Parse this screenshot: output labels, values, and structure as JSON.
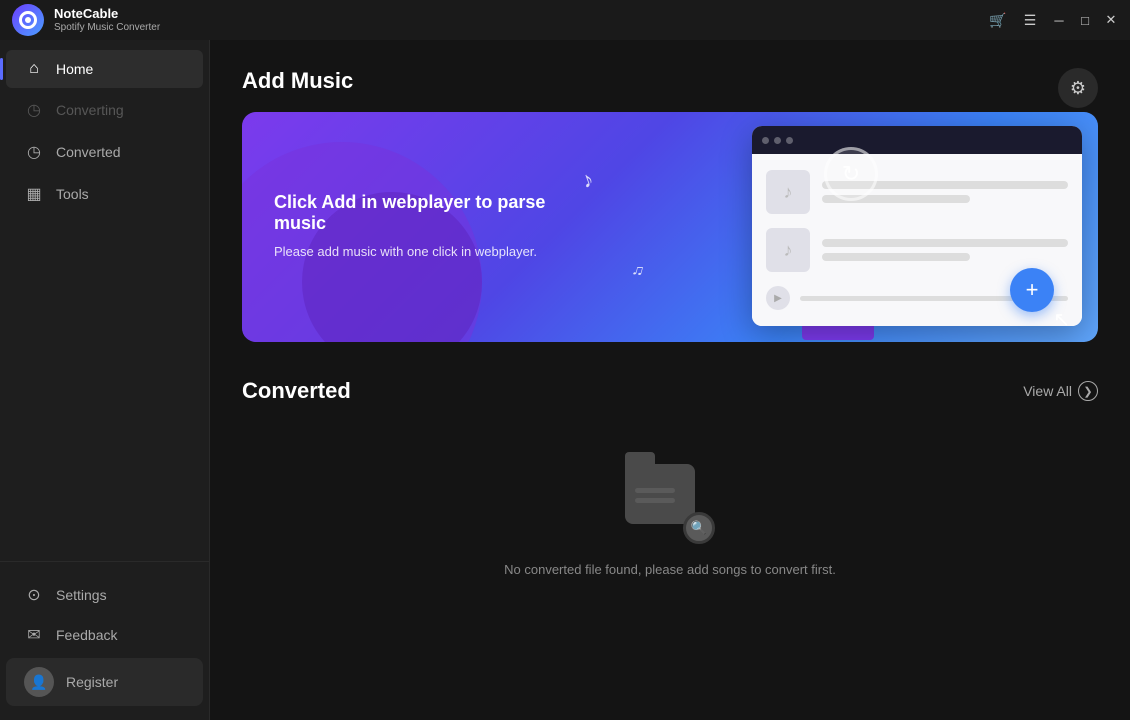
{
  "app": {
    "name": "NoteCable",
    "subtitle": "Spotify Music Converter"
  },
  "titlebar": {
    "cart_icon": "🛒",
    "menu_icon": "☰",
    "minimize_icon": "─",
    "maximize_icon": "□",
    "close_icon": "✕"
  },
  "sidebar": {
    "nav_items": [
      {
        "id": "home",
        "label": "Home",
        "icon": "⊞",
        "active": true,
        "disabled": false
      },
      {
        "id": "converting",
        "label": "Converting",
        "icon": "◷",
        "active": false,
        "disabled": true
      },
      {
        "id": "converted",
        "label": "Converted",
        "icon": "◷",
        "active": false,
        "disabled": false
      },
      {
        "id": "tools",
        "label": "Tools",
        "icon": "⊟",
        "active": false,
        "disabled": false
      }
    ],
    "bottom_items": [
      {
        "id": "settings",
        "label": "Settings",
        "icon": "⊙"
      },
      {
        "id": "feedback",
        "label": "Feedback",
        "icon": "✉"
      }
    ],
    "register_label": "Register"
  },
  "main": {
    "add_music_title": "Add Music",
    "settings_icon": "⊞",
    "banner": {
      "title": "Click Add in webplayer to parse music",
      "subtitle": "Please add music with one click in webplayer."
    },
    "converted_title": "Converted",
    "view_all_label": "View All",
    "empty_message": "No converted file found, please add songs to convert first."
  }
}
